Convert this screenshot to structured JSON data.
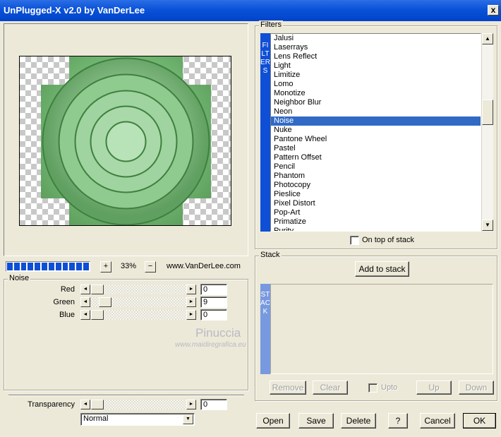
{
  "window": {
    "title": "UnPlugged-X v2.0 by VanDerLee",
    "close_glyph": "x"
  },
  "filters": {
    "group_label": "Filters",
    "banner": "FILTERS",
    "items": [
      "Jalusi",
      "Laserrays",
      "Lens Reflect",
      "Light",
      "Limitize",
      "Lomo",
      "Monotize",
      "Neighbor Blur",
      "Neon",
      "Noise",
      "Nuke",
      "Pantone Wheel",
      "Pastel",
      "Pattern Offset",
      "Pencil",
      "Phantom",
      "Photocopy",
      "Pieslice",
      "Pixel Distort",
      "Pop-Art",
      "Primatize",
      "Purity"
    ],
    "selected": "Noise",
    "on_top_of_stack_label": "On top of stack",
    "on_top_of_stack_checked": false,
    "scroll_up": "▲",
    "scroll_down": "▼"
  },
  "zoom": {
    "plus": "+",
    "minus": "−",
    "value": "33%",
    "progress_blocks": 12,
    "website": "www.VanDerLee.com"
  },
  "noise": {
    "group_label": "Noise",
    "sliders": [
      {
        "label": "Red",
        "value": "0"
      },
      {
        "label": "Green",
        "value": "9"
      },
      {
        "label": "Blue",
        "value": "0"
      }
    ],
    "arrow_left": "◄",
    "arrow_right": "►"
  },
  "transparency": {
    "label": "Transparency",
    "value": "0",
    "blend_mode": "Normal",
    "dropdown_arrow": "▼"
  },
  "stack": {
    "group_label": "Stack",
    "add_button": "Add to stack",
    "banner": "STACK",
    "remove": "Remove",
    "clear": "Clear",
    "upto": "Upto",
    "up": "Up",
    "down": "Down"
  },
  "actions": {
    "open": "Open",
    "save": "Save",
    "delete": "Delete",
    "help": "?",
    "cancel": "Cancel",
    "ok": "OK"
  },
  "watermark": {
    "name": "Pinuccia",
    "site": "www.maidiregrafica.eu"
  },
  "colors": {
    "titlebar": "#0a52d8",
    "selection": "#316ac5",
    "banner_filters": "#0f4fd6",
    "banner_stack": "#7799e0",
    "preview_green": "#6fb46f"
  }
}
